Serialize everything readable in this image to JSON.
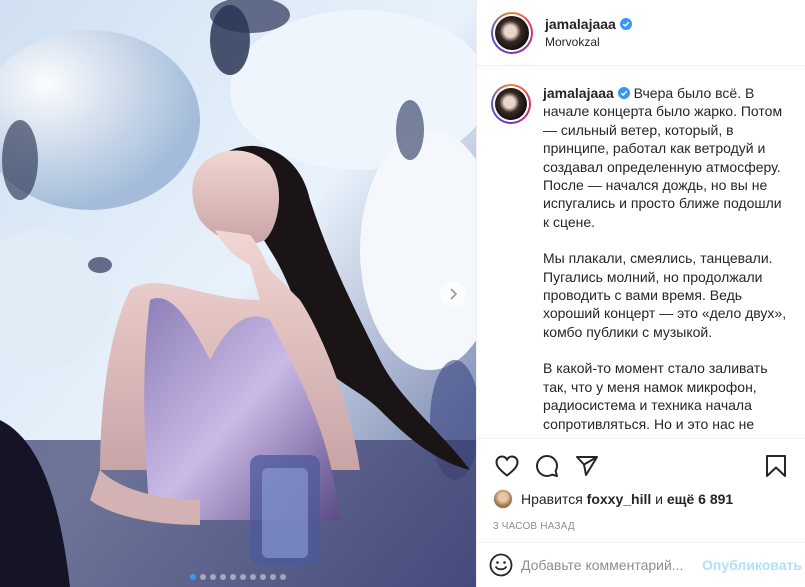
{
  "post": {
    "username": "jamalajaaa",
    "location": "Morvokzal",
    "caption_paragraphs": [
      "Вчера было всё. В начале концерта было жарко. Потом — сильный ветер, который, в принципе, работал как ветродуй и создавал определенную атмосферу. После — начался дождь, но вы не испугались и просто ближе подошли к сцене.",
      "Мы плакали, смеялись, танцевали. Пугались молний, но продолжали проводить с вами время. Ведь хороший концерт — это «дело двух», комбо публики с музыкой.",
      "В какой-то момент стало заливать так, что у меня намок микрофон, радиосистема и техника начала сопротивляться. Но и это нас не"
    ],
    "likes": {
      "prefix": "Нравится",
      "user": "foxxy_hill",
      "conjunction": "и",
      "more": "ещё 6 891"
    },
    "time_ago": "3 часов назад",
    "comment_placeholder": "Добавьте комментарий...",
    "publish_label": "Опубликовать"
  },
  "carousel": {
    "total": 10,
    "active_index": 0
  },
  "colors": {
    "accent": "#3897f0",
    "publish_disabled": "#b2dffc",
    "verified": "#3897f0"
  },
  "icons": [
    "heart-icon",
    "comment-icon",
    "share-icon",
    "bookmark-icon",
    "emoji-icon",
    "verified-icon",
    "chevron-right-icon"
  ]
}
